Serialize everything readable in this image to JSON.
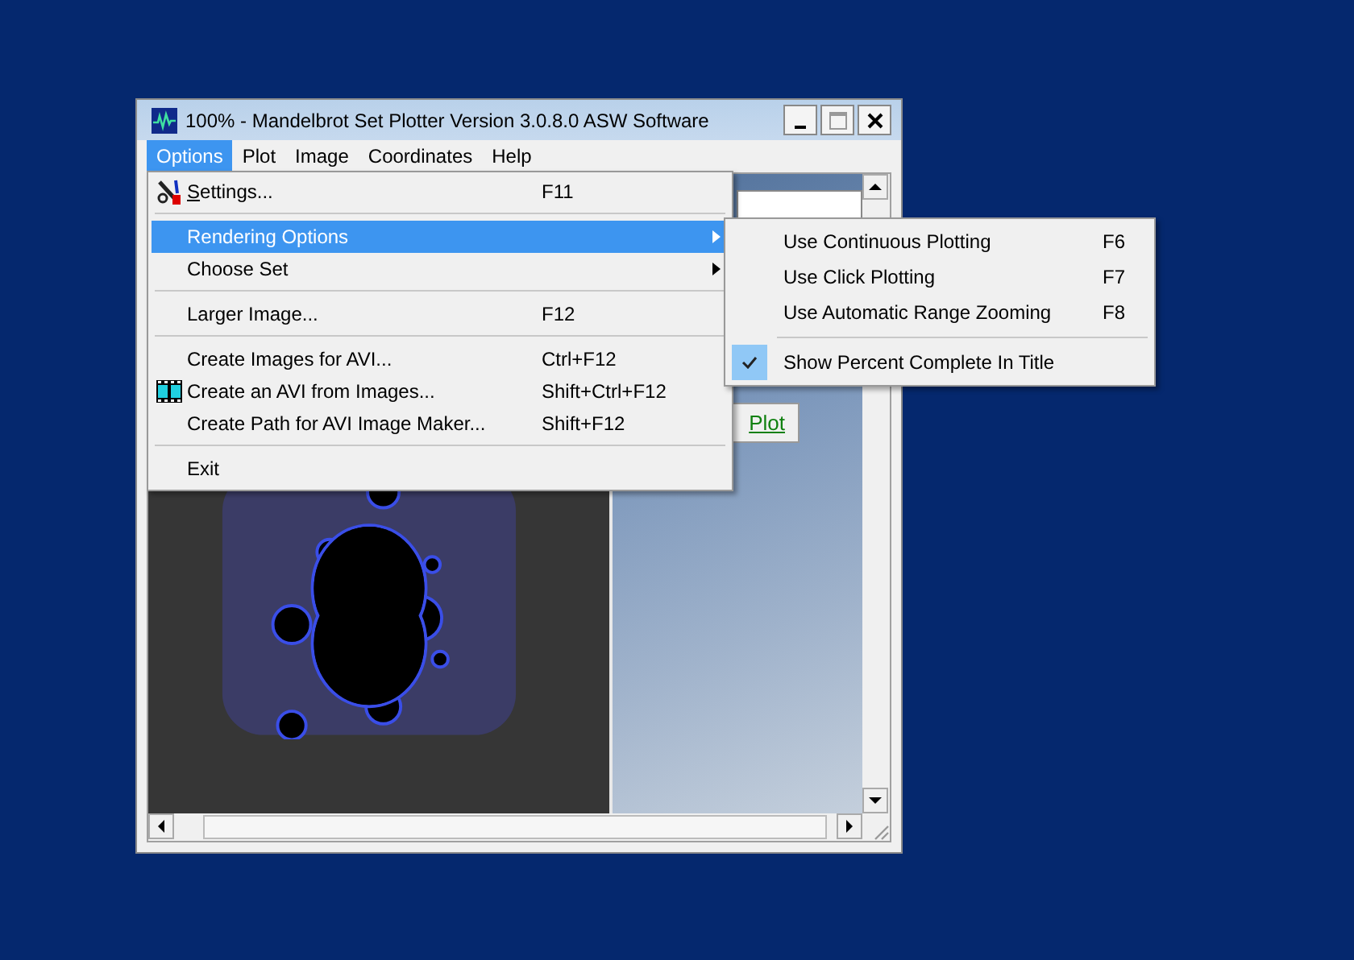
{
  "window": {
    "title": "100% - Mandelbrot Set Plotter Version 3.0.8.0  ASW Software"
  },
  "menu_bar": [
    {
      "label": "Options",
      "selected": true
    },
    {
      "label": "Plot",
      "selected": false
    },
    {
      "label": "Image",
      "selected": false
    },
    {
      "label": "Coordinates",
      "selected": false
    },
    {
      "label": "Help",
      "selected": false
    }
  ],
  "options_menu": {
    "items": [
      {
        "kind": "item",
        "label": "Settings...",
        "shortcut": "F11",
        "mnemonic": true,
        "highlighted": false,
        "submenu": false
      },
      {
        "kind": "separator"
      },
      {
        "kind": "item",
        "label": "Rendering Options",
        "mnemonic": false,
        "highlighted": true,
        "submenu": true
      },
      {
        "kind": "item",
        "label": "Choose Set",
        "mnemonic": false,
        "highlighted": false,
        "submenu": true
      },
      {
        "kind": "separator"
      },
      {
        "kind": "item",
        "label": "Larger Image...",
        "shortcut": "F12",
        "mnemonic": false,
        "highlighted": false,
        "submenu": false
      },
      {
        "kind": "separator"
      },
      {
        "kind": "item",
        "label": "Create Images for AVI...",
        "shortcut": "Ctrl+F12",
        "mnemonic": false,
        "highlighted": false,
        "submenu": false
      },
      {
        "kind": "item",
        "label": "Create an AVI from Images...",
        "shortcut": "Shift+Ctrl+F12",
        "mnemonic": false,
        "highlighted": false,
        "submenu": false
      },
      {
        "kind": "item",
        "label": "Create Path for AVI Image Maker...",
        "shortcut": "Shift+F12",
        "mnemonic": false,
        "highlighted": false,
        "submenu": false
      },
      {
        "kind": "separator"
      },
      {
        "kind": "item",
        "label": "Exit",
        "mnemonic": false,
        "highlighted": false,
        "submenu": false
      }
    ]
  },
  "rendering_submenu": {
    "items": [
      {
        "kind": "item",
        "label": "Use Continuous Plotting",
        "shortcut": "F6",
        "checked": false
      },
      {
        "kind": "item",
        "label": "Use Click Plotting",
        "shortcut": "F7",
        "checked": false
      },
      {
        "kind": "item",
        "label": "Use Automatic Range Zooming",
        "shortcut": "F8",
        "checked": false
      },
      {
        "kind": "separator"
      },
      {
        "kind": "item",
        "label": "Show Percent Complete In Title",
        "checked": true
      }
    ]
  },
  "plot_button": {
    "label": "Plot"
  }
}
